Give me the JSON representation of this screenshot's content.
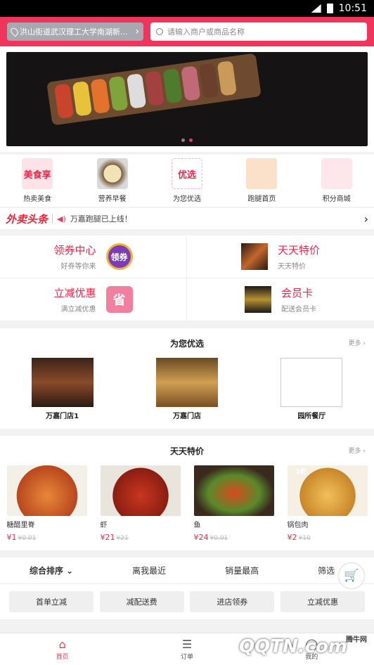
{
  "status_bar": {
    "time": "10:51"
  },
  "header": {
    "location": "洪山街道武汉理工大学南湖新...",
    "search_placeholder": "请输入商户或商品名称"
  },
  "categories": [
    {
      "label": "热卖美食",
      "icon": "hot-food-icon",
      "art": "美食享"
    },
    {
      "label": "营养早餐",
      "icon": "breakfast-icon",
      "art": ""
    },
    {
      "label": "为您优选",
      "icon": "selection-icon",
      "art": "优选"
    },
    {
      "label": "跑腿首页",
      "icon": "courier-icon",
      "art": ""
    },
    {
      "label": "积分商城",
      "icon": "points-mall-icon",
      "art": ""
    }
  ],
  "news": {
    "logo": "外卖头条",
    "text": "万嘉跑腿已上线！"
  },
  "promos": [
    {
      "title": "领券中心",
      "subtitle": "好券等你来",
      "icon_text": "领券"
    },
    {
      "title": "天天特价",
      "subtitle": "天天特价",
      "icon_text": ""
    },
    {
      "title": "立减优惠",
      "subtitle": "满立减优惠",
      "icon_text": "省"
    },
    {
      "title": "会员卡",
      "subtitle": "配送会员卡",
      "icon_text": ""
    }
  ],
  "selection": {
    "title": "为您优选",
    "more": "更多",
    "shops": [
      {
        "name": "万嘉门店1"
      },
      {
        "name": "万嘉门店"
      },
      {
        "name": "园所餐厅"
      }
    ]
  },
  "deals": {
    "title": "天天特价",
    "more": "更多",
    "items": [
      {
        "name": "糖醋里脊",
        "price": "¥1",
        "old": "¥0.01",
        "badge": ""
      },
      {
        "name": "虾",
        "price": "¥21",
        "old": "¥21",
        "badge": ""
      },
      {
        "name": "鱼",
        "price": "¥24",
        "old": "¥0.01",
        "badge": ""
      },
      {
        "name": "锅包肉",
        "price": "¥2",
        "old": "¥10",
        "badge": "2折"
      }
    ]
  },
  "sort": [
    "综合排序",
    "离我最近",
    "销量最高",
    "筛选"
  ],
  "filters": [
    "首单立减",
    "减配送费",
    "进店领券",
    "立减优惠"
  ],
  "tabs": [
    {
      "label": "首页",
      "icon": "home-icon"
    },
    {
      "label": "订单",
      "icon": "orders-icon"
    },
    {
      "label": "我的",
      "icon": "profile-icon"
    }
  ],
  "watermark": {
    "text": "QQTN.com",
    "site": "腾牛网"
  },
  "colors": {
    "brand": "#f0355c",
    "price": "#e8284a"
  }
}
